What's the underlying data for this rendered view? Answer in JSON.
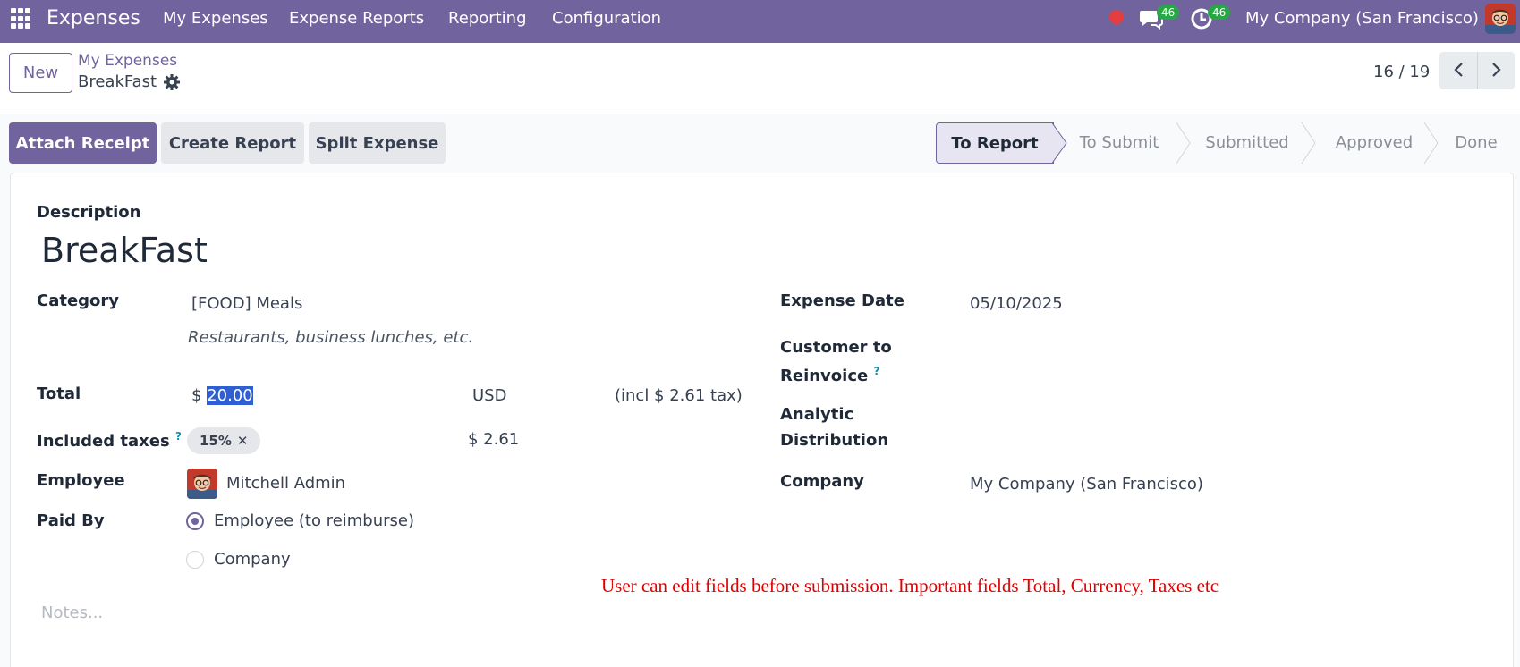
{
  "navbar": {
    "app_name": "Expenses",
    "menu": [
      "My Expenses",
      "Expense Reports",
      "Reporting",
      "Configuration"
    ],
    "chat_badge": "46",
    "activity_badge": "46",
    "company": "My Company (San Francisco)",
    "bg_color": "#71639e"
  },
  "control": {
    "new_label": "New",
    "breadcrumb_parent": "My Expenses",
    "breadcrumb_current": "BreakFast",
    "pager": "16 / 19"
  },
  "actions": {
    "attach_receipt": "Attach Receipt",
    "create_report": "Create Report",
    "split_expense": "Split Expense"
  },
  "statusbar": {
    "stages": [
      "To Report",
      "To Submit",
      "Submitted",
      "Approved",
      "Done"
    ],
    "active": "To Report"
  },
  "form": {
    "description_label": "Description",
    "description": "BreakFast",
    "category_label": "Category",
    "category": "[FOOD] Meals",
    "category_hint": "Restaurants, business lunches, etc.",
    "total_label": "Total",
    "currency_symbol": "$",
    "total": "20.00",
    "currency": "USD",
    "tax_note": "(incl $ 2.61 tax)",
    "taxes_label": "Included taxes",
    "help_mark": "?",
    "tax_tag": "15%",
    "tax_amount": "$ 2.61",
    "employee_label": "Employee",
    "employee": "Mitchell Admin",
    "paid_by_label": "Paid By",
    "paid_by_options": [
      "Employee (to reimburse)",
      "Company"
    ],
    "paid_by_selected": "Employee (to reimburse)",
    "expense_date_label": "Expense Date",
    "expense_date": "05/10/2025",
    "customer_label_1": "Customer to",
    "customer_label_2": "Reinvoice",
    "analytic_label_1": "Analytic",
    "analytic_label_2": "Distribution",
    "company_label": "Company",
    "company": "My Company (San Francisco)",
    "notes_placeholder": "Notes..."
  },
  "annotation": {
    "text": "User can edit fields before submission. Important fields Total, Currency, Taxes etc",
    "color": "#e00000"
  }
}
